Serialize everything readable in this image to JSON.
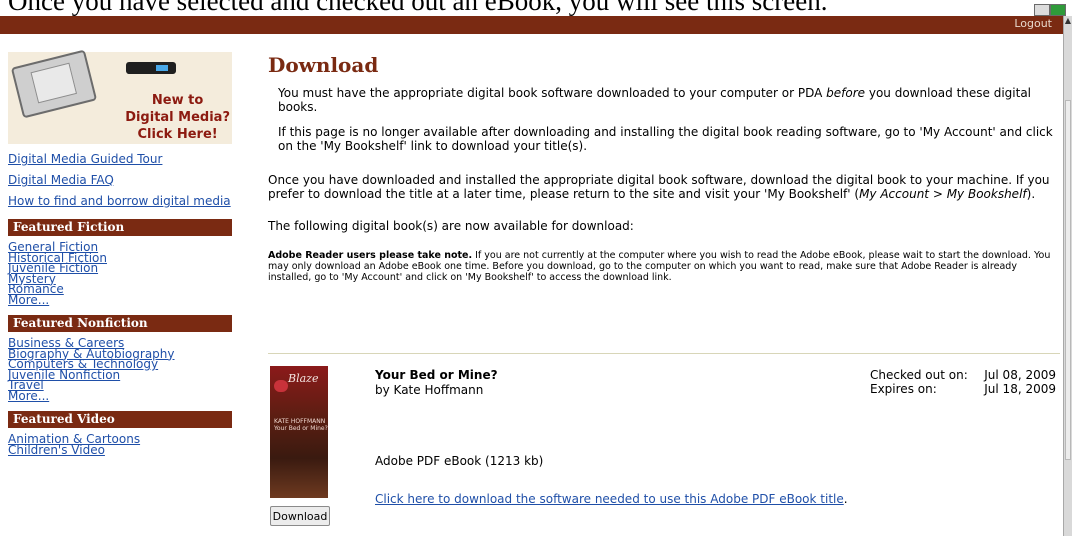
{
  "caption": "Once you have selected and checked out an eBook, you will see this screen.",
  "header": {
    "logout": "Logout"
  },
  "sidebar": {
    "promo_lines": [
      "New to",
      "Digital Media?",
      "Click Here!"
    ],
    "links": [
      "Digital Media Guided Tour",
      "Digital Media FAQ",
      "How to find and borrow digital media"
    ],
    "sections": [
      {
        "heading": "Featured Fiction",
        "items": [
          "General Fiction",
          "Historical Fiction",
          "Juvenile Fiction",
          "Mystery",
          "Romance",
          "More..."
        ]
      },
      {
        "heading": "Featured Nonfiction",
        "items": [
          "Business & Careers",
          "Biography & Autobiography",
          "Computers & Technology",
          "Juvenile Nonfiction",
          "Travel",
          "More..."
        ]
      },
      {
        "heading": "Featured Video",
        "items": [
          "Animation & Cartoons",
          "Children's Video"
        ]
      }
    ]
  },
  "main": {
    "title": "Download",
    "p1_a": "You must have the appropriate digital book software downloaded to your computer or PDA ",
    "p1_em": "before",
    "p1_b": " you download these digital books.",
    "p2": "If this page is no longer available after downloading and installing the digital book reading software, go to 'My Account' and click on the 'My Bookshelf' link to download your title(s).",
    "p3_a": "Once you have downloaded and installed the appropriate digital book software, download the digital book to your machine. If you prefer to download the title at a later time, please return to the site and visit your 'My Bookshelf' (",
    "p3_em": "My Account > My Bookshelf",
    "p3_b": ").",
    "p4": "The following digital book(s) are now available for download:",
    "note_bold": "Adobe Reader users please take note.",
    "note_rest": " If you are not currently at the computer where you wish to read the Adobe eBook, please wait to start the download. You may only download an Adobe eBook one time. Before you download, go to the computer on which you want to read, make sure that Adobe Reader is already installed, go to 'My Account' and click on 'My Bookshelf' to access the download link."
  },
  "book": {
    "title": "Your Bed or Mine?",
    "author": "by Kate Hoffmann",
    "checked_label": "Checked out on:",
    "checked_date": "Jul 08, 2009",
    "expires_label": "Expires on:",
    "expires_date": "Jul 18, 2009",
    "format": "Adobe PDF eBook (1213 kb)",
    "software_link": "Click here to download the software needed to use this Adobe PDF eBook title",
    "software_link_end": ".",
    "download_button": "Download",
    "cover_text": {
      "series": "Blaze",
      "author": "KATE HOFFMANN",
      "title": "Your Bed or Mine?"
    }
  },
  "colors": {
    "header": "#7a2a12",
    "link": "#1f4fa8",
    "title": "#7a2a12",
    "promo_text": "#8c1a10"
  }
}
